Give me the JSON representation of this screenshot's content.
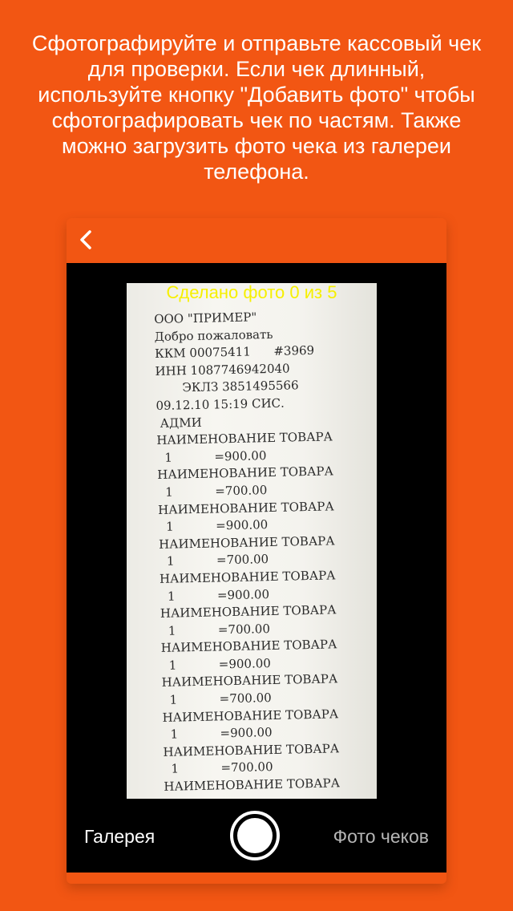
{
  "instruction": "Сфотографируйте и отправьте кассовый чек для проверки. Если чек длинный, используйте кнопку \"Добавить фото\" чтобы сфотографировать чек по частям. Также можно загрузить фото чека из галереи телефона.",
  "nav": {
    "back_icon": "chevron-left-icon"
  },
  "camera": {
    "photo_counter": "Сделано фото 0 из 5",
    "receipt_lines": [
      "ООО \"ПРИМЕР\"",
      "Добро пожаловать",
      "ККМ 00075411      #3969",
      "ИНН 1087746942040",
      "       ЭКЛЗ 3851495566",
      "09.12.10 15:19 СИС.",
      " АДМИ",
      "НАИМЕНОВАНИЕ ТОВАРА",
      "  1           =900.00",
      "НАИМЕНОВАНИЕ ТОВАРА",
      "  1           =700.00",
      "НАИМЕНОВАНИЕ ТОВАРА",
      "  1           =900.00",
      "НАИМЕНОВАНИЕ ТОВАРА",
      "  1           =700.00",
      "НАИМЕНОВАНИЕ ТОВАРА",
      "  1           =900.00",
      "НАИМЕНОВАНИЕ ТОВАРА",
      "  1           =700.00",
      "НАИМЕНОВАНИЕ ТОВАРА",
      "  1           =900.00",
      "НАИМЕНОВАНИЕ ТОВАРА",
      "  1           =700.00",
      "НАИМЕНОВАНИЕ ТОВАРА",
      "  1           =900.00",
      "НАИМЕНОВАНИЕ ТОВАРА",
      "  1           =700.00",
      "НАИМЕНОВАНИЕ ТОВАРА"
    ]
  },
  "bottom_bar": {
    "gallery_label": "Галерея",
    "receipts_label": "Фото чеков"
  },
  "colors": {
    "accent": "#f25613",
    "counter_text": "#f6f000",
    "inactive_label": "#b6b6b6"
  }
}
